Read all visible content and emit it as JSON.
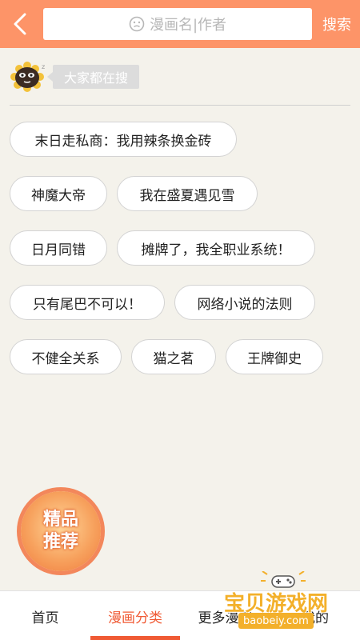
{
  "header": {
    "search_placeholder": "漫画名|作者",
    "search_button": "搜索"
  },
  "hot": {
    "label": "大家都在搜"
  },
  "tags": [
    "末日走私商：我用辣条换金砖",
    "神魔大帝",
    "我在盛夏遇见雪",
    "日月同错",
    "摊牌了，我全职业系统！",
    "只有尾巴不可以！",
    "网络小说的法则",
    "不健全关系",
    "猫之茗",
    "王牌御史"
  ],
  "badge": {
    "line1": "精品",
    "line2": "推荐"
  },
  "bottom_nav": {
    "items": [
      "首页",
      "漫画分类",
      "更多漫画",
      "我的"
    ],
    "active_index": 1,
    "active_color": "#f05a34"
  },
  "watermark": {
    "text": "宝贝游戏网",
    "url": "baobeiy.com"
  },
  "colors": {
    "header": "#fd9468",
    "background": "#f4f2eb"
  }
}
